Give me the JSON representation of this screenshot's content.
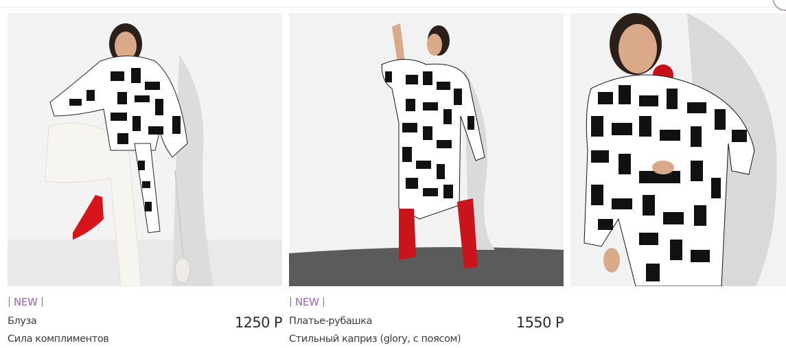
{
  "products": [
    {
      "badge": "NEW",
      "name": "Блуза",
      "description": "Сила комплиментов",
      "price": "1250 Р",
      "photo_icon": "blouse-photo"
    },
    {
      "badge": "NEW",
      "name": "Платье-рубашка",
      "description": "Стильный каприз (glory, с поясом)",
      "price": "1550 Р",
      "photo_icon": "dress-photo"
    },
    {
      "photo_icon": "dress-closeup-photo"
    }
  ],
  "colors": {
    "accent": "#9a63b8",
    "text": "#3a3a3a",
    "badge_ring": "#b59ad0"
  }
}
